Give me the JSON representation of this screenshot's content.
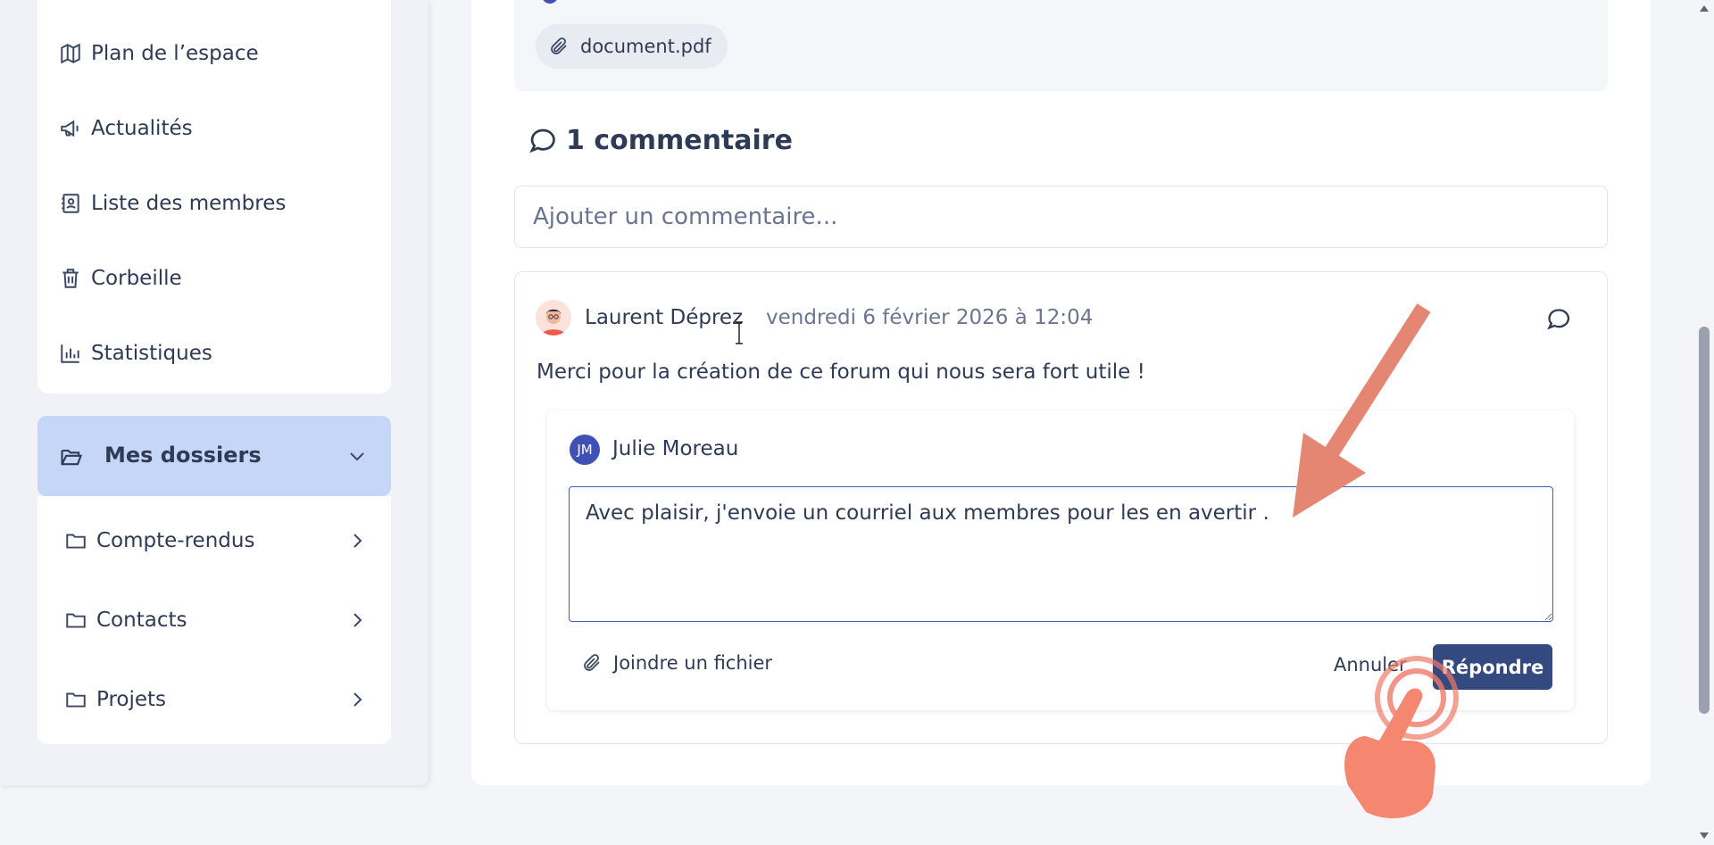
{
  "sidebar": {
    "nav_items": [
      {
        "label": "Plan de l’espace",
        "icon": "map-icon"
      },
      {
        "label": "Actualités",
        "icon": "megaphone-icon"
      },
      {
        "label": "Liste des membres",
        "icon": "contacts-book-icon"
      },
      {
        "label": "Corbeille",
        "icon": "trash-icon"
      },
      {
        "label": "Statistiques",
        "icon": "bar-chart-icon"
      }
    ],
    "folders_header": {
      "label": "Mes dossiers",
      "icon": "folder-open-icon"
    },
    "folders": [
      {
        "label": "Compte-rendus",
        "icon": "folder-icon"
      },
      {
        "label": "Contacts",
        "icon": "folder-icon"
      },
      {
        "label": "Projets",
        "icon": "folder-icon"
      }
    ]
  },
  "post": {
    "attachment": {
      "name": "document.pdf",
      "icon": "paperclip-icon"
    }
  },
  "comments": {
    "title": "1 commentaire",
    "add_placeholder": "Ajouter un commentaire...",
    "items": [
      {
        "author": "Laurent Déprez",
        "timestamp": "vendredi 6 février 2026 à 12:04",
        "text": "Merci pour la création de ce forum qui nous sera fort utile !"
      }
    ]
  },
  "reply": {
    "user_initials": "JM",
    "user_name": "Julie Moreau",
    "text": "Avec plaisir, j'envoie un courriel aux membres pour les en avertir .",
    "attach_label": "Joindre un fichier",
    "cancel_label": "Annuler",
    "submit_label": "Répondre"
  },
  "colors": {
    "accent": "#34497f",
    "avatar_blue": "#3f51b5",
    "folder_header_bg": "#c5d6f6",
    "annotation": "#e58673"
  }
}
